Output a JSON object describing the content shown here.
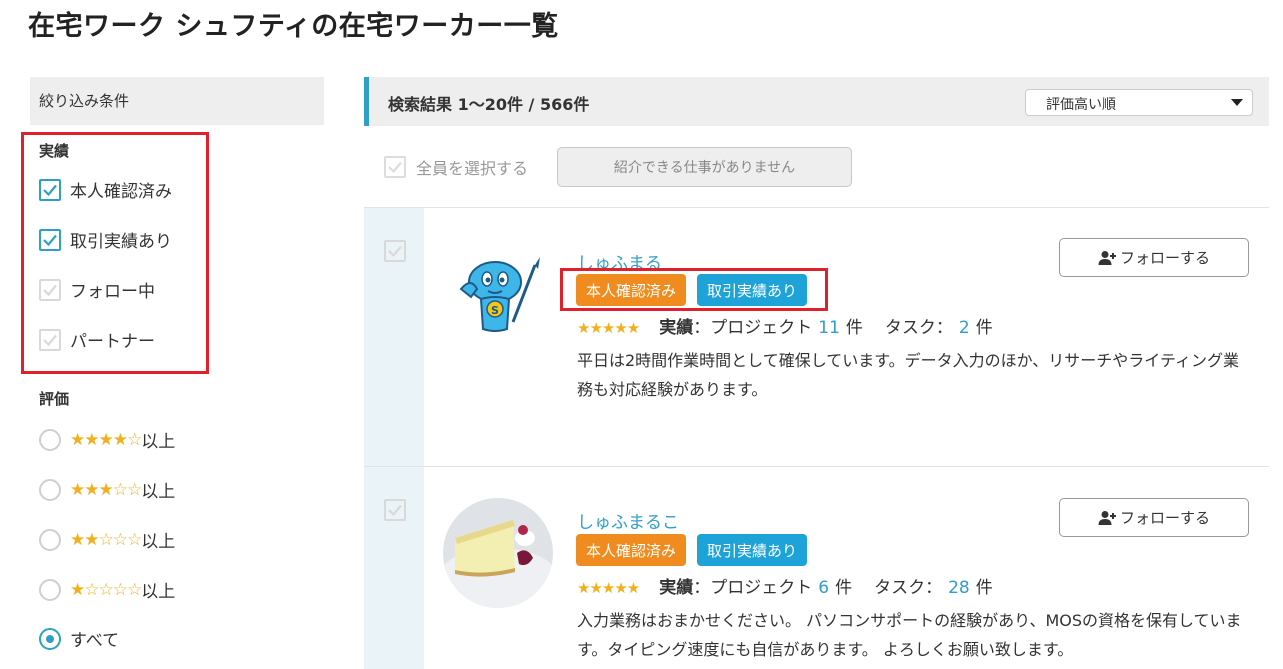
{
  "page_title": "在宅ワーク シュフティの在宅ワーカー一覧",
  "sidebar": {
    "header": "絞り込み条件",
    "achievements": {
      "label": "実績",
      "options": [
        {
          "label": "本人確認済み",
          "checked": true
        },
        {
          "label": "取引実績あり",
          "checked": true
        },
        {
          "label": "フォロー中",
          "checked": false
        },
        {
          "label": "パートナー",
          "checked": false
        }
      ]
    },
    "rating": {
      "label": "評価",
      "suffix": "以上",
      "options": [
        {
          "stars": 4,
          "selected": false
        },
        {
          "stars": 3,
          "selected": false
        },
        {
          "stars": 2,
          "selected": false
        },
        {
          "stars": 1,
          "selected": false
        }
      ],
      "all_label": "すべて",
      "all_selected": true
    }
  },
  "results": {
    "summary": "検索結果 1～20件 / 566件",
    "sort_selected": "評価高い順",
    "select_all_label": "全員を選択する",
    "intro_button_label": "紹介できる仕事がありません",
    "stats_label_strong": "実績",
    "stats_label_project": "：プロジェクト",
    "stats_label_task": "タスク：",
    "count_unit": "件",
    "follow_label": "フォローする"
  },
  "workers": [
    {
      "name": "しゅふまる",
      "badges": [
        "本人確認済み",
        "取引実績あり"
      ],
      "rating": 5,
      "projects": "11",
      "tasks": "2",
      "description": "平日は2時間作業時間として確保しています。データ入力のほか、リサーチやライティング業務も対応経験があります。"
    },
    {
      "name": "しゅふまるこ",
      "badges": [
        "本人確認済み",
        "取引実績あり"
      ],
      "rating": 5,
      "projects": "6",
      "tasks": "28",
      "description": "入力業務はおまかせください。 パソコンサポートの経験があり、MOSの資格を保有しています。タイピング速度にも自信があります。 よろしくお願い致します。"
    }
  ],
  "colors": {
    "accent": "#2e9fc8",
    "badge_orange": "#f08c1f",
    "badge_blue": "#1ea3d9",
    "highlight_red": "#e0212b",
    "star": "#f2b01e"
  }
}
